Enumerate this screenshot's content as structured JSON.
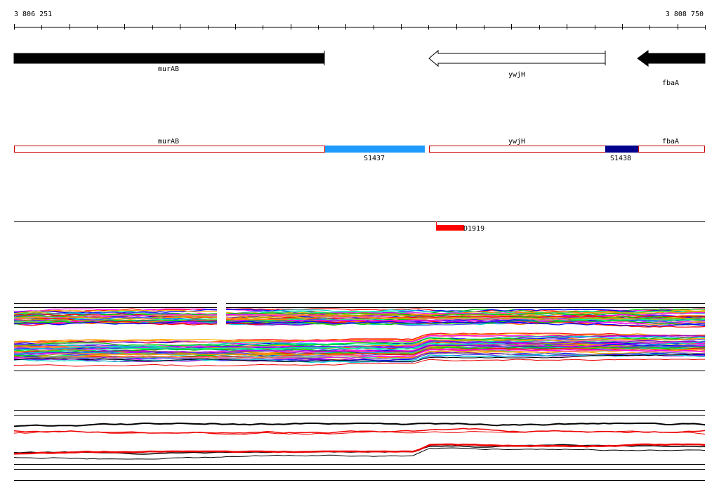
{
  "ruler": {
    "start_label": "3 806 251",
    "end_label": "3 808 750"
  },
  "genes": [
    {
      "name": "murAB",
      "strand": "+",
      "fill": "#000000",
      "label": "murAB"
    },
    {
      "name": "ywjH",
      "strand": "-",
      "fill": "#ffffff",
      "label": "ywjH"
    },
    {
      "name": "fbaA",
      "strand": "-",
      "fill": "#000000",
      "label": "fbaA"
    }
  ],
  "segments": {
    "boxes": [
      {
        "label": "murAB",
        "outline": "#cc0000"
      },
      {
        "label": "ywjH",
        "outline": "#cc0000"
      },
      {
        "label": "fbaA",
        "outline": "#cc0000"
      }
    ],
    "features": [
      {
        "label": "S1437",
        "color": "#1e9bff"
      },
      {
        "label": "S1438",
        "color": "#00008b"
      }
    ]
  },
  "antisense_feature": {
    "label": "D1919",
    "color": "#ff0000"
  },
  "colors": {
    "line": "#000000",
    "red": "#ee0000",
    "track_palette": [
      "#ff0000",
      "#ff00ff",
      "#00cc00",
      "#0000ff",
      "#00cccc",
      "#ffaa00",
      "#8800cc",
      "#aaaa00",
      "#ff66aa",
      "#00ff88",
      "#ff8800",
      "#4444ff"
    ]
  }
}
